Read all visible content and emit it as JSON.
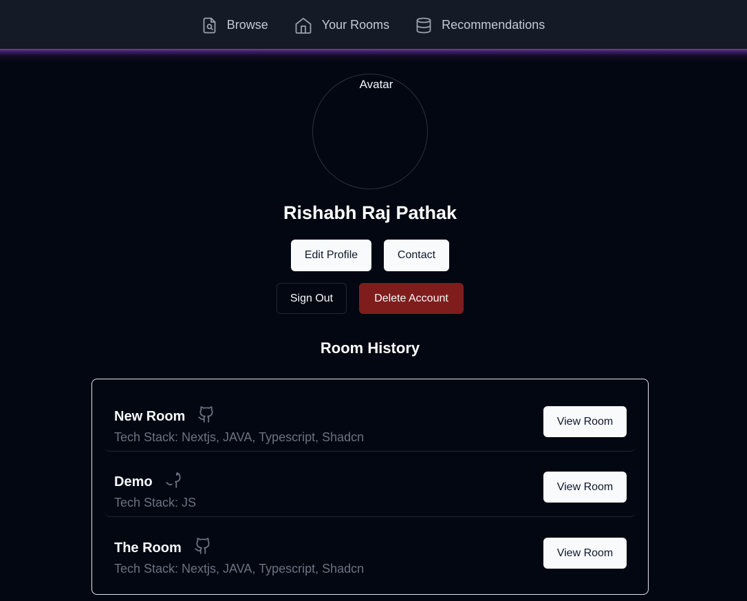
{
  "nav": {
    "items": [
      {
        "label": "Browse",
        "icon": "file-search-icon"
      },
      {
        "label": "Your Rooms",
        "icon": "home-icon"
      },
      {
        "label": "Recommendations",
        "icon": "database-icon"
      }
    ]
  },
  "profile": {
    "avatar_alt": "Avatar",
    "name": "Rishabh Raj Pathak",
    "edit_label": "Edit Profile",
    "contact_label": "Contact",
    "signout_label": "Sign Out",
    "delete_label": "Delete Account"
  },
  "history": {
    "title": "Room History",
    "rooms": [
      {
        "name": "New Room",
        "stack": "Tech Stack: Nextjs, JAVA, Typescript, Shadcn",
        "button": "View Room",
        "icon": "github-icon"
      },
      {
        "name": "Demo",
        "stack": "Tech Stack: JS",
        "button": "View Room",
        "icon": "github-icon"
      },
      {
        "name": "The Room",
        "stack": "Tech Stack: Nextjs, JAVA, Typescript, Shadcn",
        "button": "View Room",
        "icon": "github-icon"
      }
    ]
  },
  "colors": {
    "background": "#030712",
    "nav_background": "#141a26",
    "danger": "#7f1d1d",
    "accent_glow": "#6b3fa0"
  }
}
